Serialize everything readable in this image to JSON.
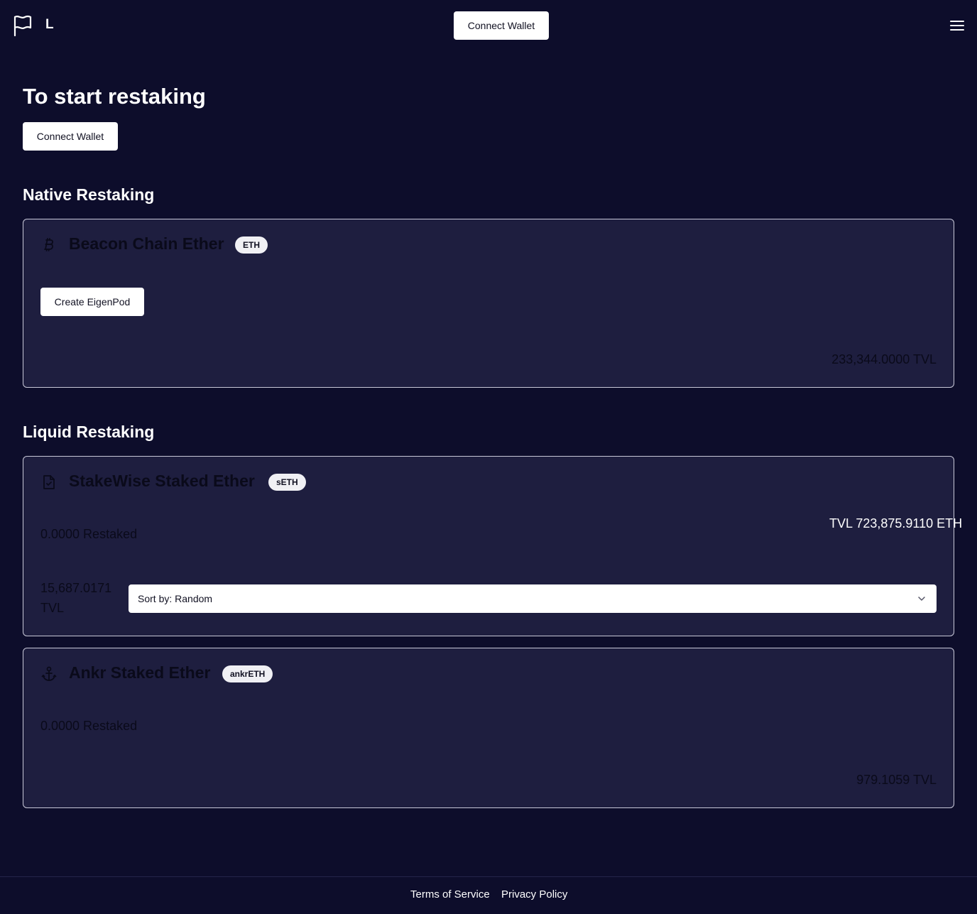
{
  "header": {
    "brand": "L",
    "connect_label": "Connect Wallet"
  },
  "hero": {
    "title": "To start restaking",
    "connect_label": "Connect Wallet"
  },
  "native": {
    "title": "Native Restaking",
    "asset": {
      "name": "Beacon Chain Ether",
      "symbol": "ETH",
      "icon": "bitcoin-icon",
      "action_label": "Create EigenPod",
      "tvl": "233,344.0000 TVL"
    }
  },
  "liquid": {
    "title": "Liquid Restaking",
    "assets": [
      {
        "name": "StakeWise Staked Ether",
        "symbol": "sETH",
        "icon": "document-icon",
        "restaked": "0.0000 Restaked",
        "tvl_overflow": "TVL 723,875.9110 ETH",
        "tvl_line1": "15,687.0171",
        "tvl_line2": "TVL",
        "sort_label": "Sort by: Random"
      },
      {
        "name": "Ankr Staked Ether",
        "symbol": "ankrETH",
        "icon": "anchor-icon",
        "restaked": "0.0000 Restaked",
        "tvl": "979.1059 TVL"
      }
    ]
  },
  "footer": {
    "terms": "Terms of Service",
    "privacy": "Privacy Policy"
  }
}
